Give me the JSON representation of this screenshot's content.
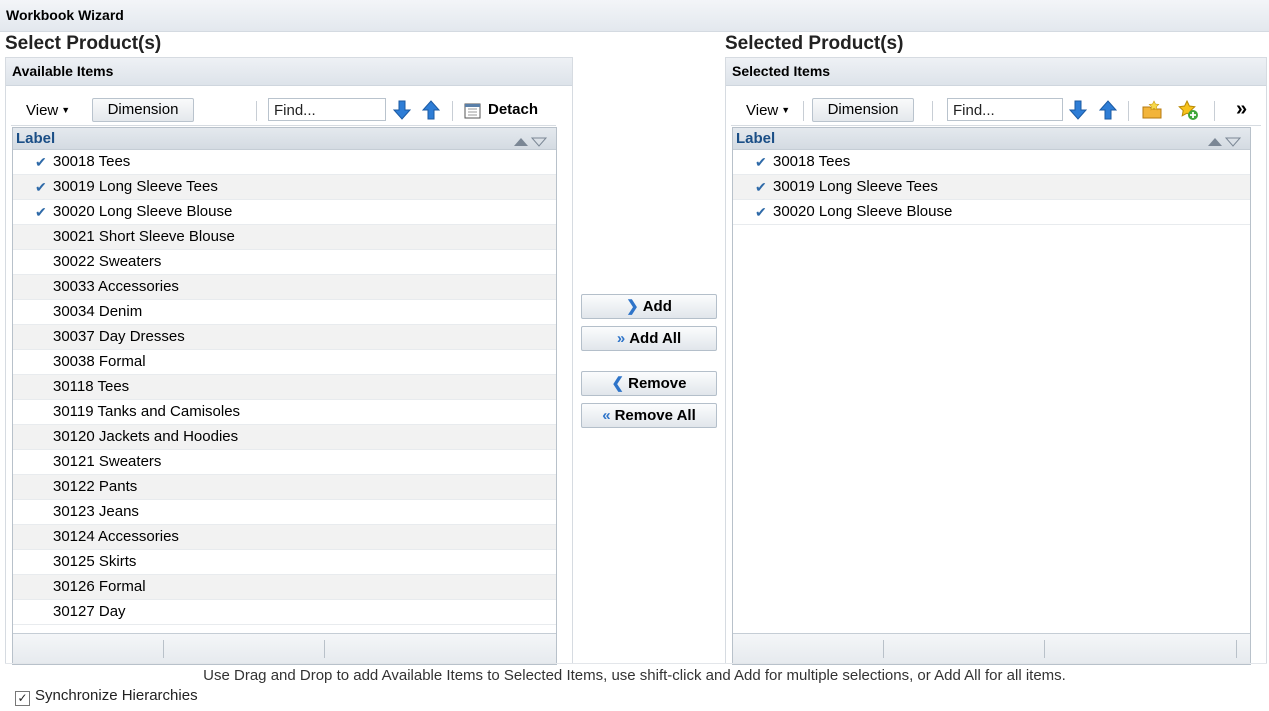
{
  "window": {
    "title": "Workbook Wizard"
  },
  "left": {
    "section_title": "Select Product(s)",
    "panel_title": "Available Items",
    "toolbar": {
      "view": "View",
      "dimension": "Dimension",
      "find_placeholder": "Find...",
      "detach": "Detach"
    },
    "column_label": "Label",
    "rows": [
      {
        "label": "30018 Tees",
        "checked": true
      },
      {
        "label": "30019 Long Sleeve Tees",
        "checked": true
      },
      {
        "label": "30020 Long Sleeve Blouse",
        "checked": true
      },
      {
        "label": "30021 Short Sleeve Blouse",
        "checked": false
      },
      {
        "label": "30022 Sweaters",
        "checked": false
      },
      {
        "label": "30033 Accessories",
        "checked": false
      },
      {
        "label": "30034 Denim",
        "checked": false
      },
      {
        "label": "30037 Day Dresses",
        "checked": false
      },
      {
        "label": "30038 Formal",
        "checked": false
      },
      {
        "label": "30118 Tees",
        "checked": false
      },
      {
        "label": "30119 Tanks and Camisoles",
        "checked": false
      },
      {
        "label": "30120 Jackets and Hoodies",
        "checked": false
      },
      {
        "label": "30121 Sweaters",
        "checked": false
      },
      {
        "label": "30122 Pants",
        "checked": false
      },
      {
        "label": "30123 Jeans",
        "checked": false
      },
      {
        "label": "30124 Accessories",
        "checked": false
      },
      {
        "label": "30125 Skirts",
        "checked": false
      },
      {
        "label": "30126 Formal",
        "checked": false
      },
      {
        "label": "30127 Day",
        "checked": false
      }
    ]
  },
  "buttons": {
    "add": "Add",
    "add_all": "Add All",
    "remove": "Remove",
    "remove_all": "Remove All"
  },
  "right": {
    "section_title": "Selected Product(s)",
    "panel_title": "Selected Items",
    "toolbar": {
      "view": "View",
      "dimension": "Dimension",
      "find_placeholder": "Find...",
      "more": "»"
    },
    "column_label": "Label",
    "rows": [
      {
        "label": "30018 Tees",
        "checked": true
      },
      {
        "label": "30019 Long Sleeve Tees",
        "checked": true
      },
      {
        "label": "30020 Long Sleeve Blouse",
        "checked": true
      }
    ]
  },
  "hint": "Use Drag and Drop to add Available Items to Selected Items, use shift-click and Add for multiple selections, or Add All for all items.",
  "sync": {
    "label": "Synchronize Hierarchies",
    "checked": true
  },
  "colors": {
    "accent": "#2e74c9",
    "label_header": "#1a4e86",
    "check": "#2f6aa8"
  }
}
